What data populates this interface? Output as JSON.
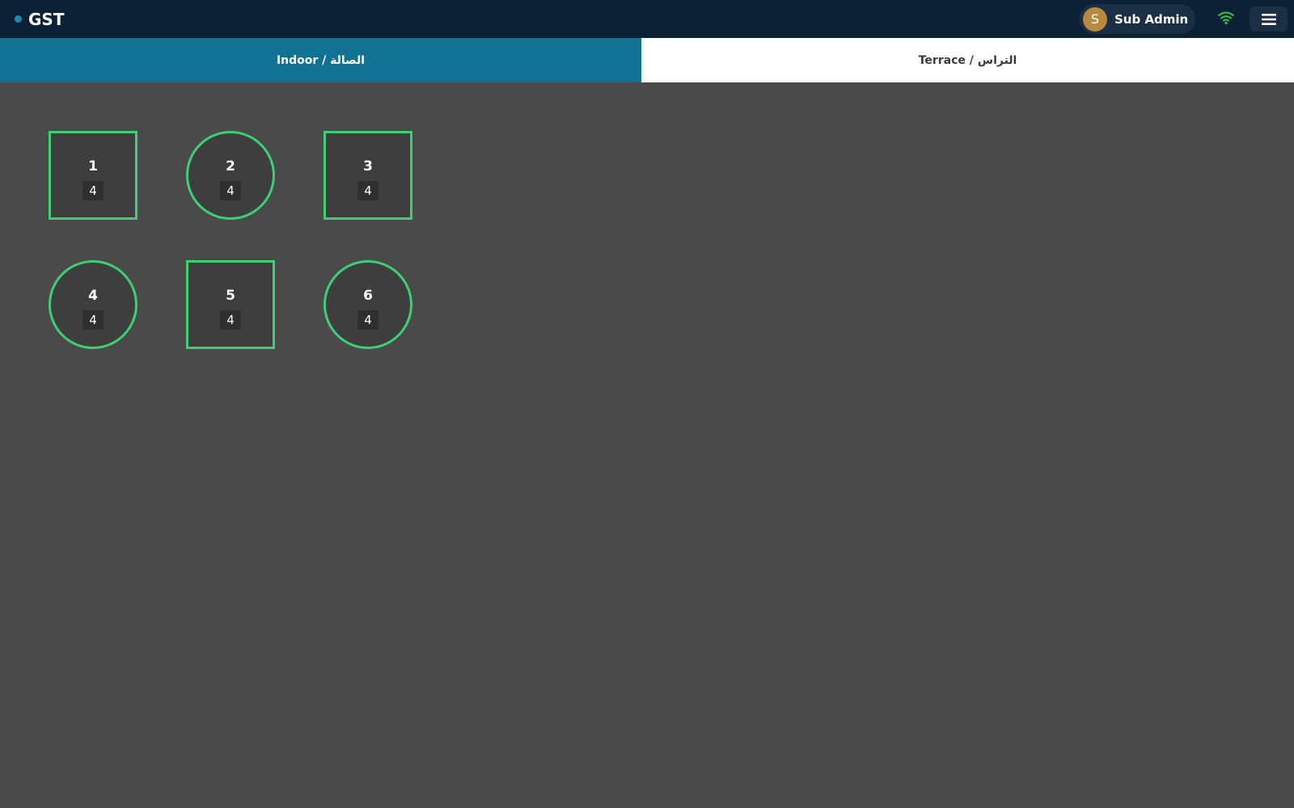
{
  "header": {
    "brand": "GST",
    "user": {
      "initial": "S",
      "name": "Sub Admin"
    },
    "icons": {
      "connection": "wifi-icon",
      "menu": "hamburger-menu-icon"
    },
    "colors": {
      "connection_ok": "#2ecc40",
      "accent": "#127293"
    }
  },
  "tabs": [
    {
      "label": "Indoor / الصالة",
      "active": true
    },
    {
      "label": "Terrace / التراس",
      "active": false
    }
  ],
  "tables": [
    {
      "number": "1",
      "seats": "4",
      "shape": "square"
    },
    {
      "number": "2",
      "seats": "4",
      "shape": "round"
    },
    {
      "number": "3",
      "seats": "4",
      "shape": "square"
    },
    {
      "number": "4",
      "seats": "4",
      "shape": "round"
    },
    {
      "number": "5",
      "seats": "4",
      "shape": "square"
    },
    {
      "number": "6",
      "seats": "4",
      "shape": "round"
    }
  ],
  "status_colors": {
    "available": "#3ecf74"
  }
}
